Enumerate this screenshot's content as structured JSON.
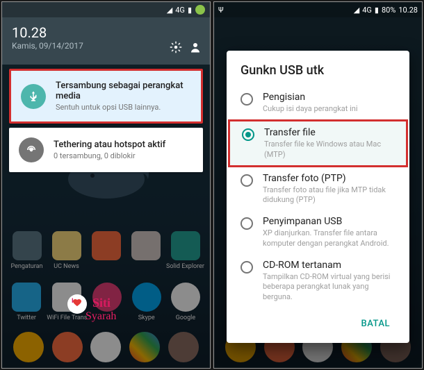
{
  "left": {
    "time": "10.28",
    "date": "Kamis, 09/14/2017",
    "signal": "4G",
    "notifications": [
      {
        "title": "Tersambung sebagai perangkat media",
        "subtitle": "Sentuh untuk opsi USB lainnya.",
        "icon": "usb-icon",
        "highlighted": true
      },
      {
        "title": "Tethering atau hotspot aktif",
        "subtitle": "0 tersambung, 0 diblokir",
        "icon": "hotspot-icon",
        "highlighted": false
      }
    ],
    "apps_row1": [
      "Pengaturan",
      "UC News",
      "",
      "",
      "Solid Explorer"
    ],
    "apps_row2": [
      "Twitter",
      "WiFi File Trans",
      "",
      "Skype",
      "Google"
    ]
  },
  "right": {
    "time": "10.28",
    "battery": "80%",
    "signal": "4G",
    "dialog_title": "Gunkn USB utk",
    "options": [
      {
        "label": "Pengisian",
        "sub": "Cukup isi daya perangkat ini",
        "checked": false,
        "highlighted": false
      },
      {
        "label": "Transfer file",
        "sub": "Transfer file ke Windows atau Mac (MTP)",
        "checked": true,
        "highlighted": true
      },
      {
        "label": "Transfer foto (PTP)",
        "sub": "Transfer foto atau file jika MTP tidak didukung (PTP)",
        "checked": false,
        "highlighted": false
      },
      {
        "label": "Penyimpanan USB",
        "sub": "XP dianjurkan. Transfer file antara komputer dengan perangkat Android.",
        "checked": false,
        "highlighted": false
      },
      {
        "label": "CD-ROM tertanam",
        "sub": "Tampilkan CD-ROM virtual yang berisi beberapa perangkat lunak yang berguna.",
        "checked": false,
        "highlighted": false
      }
    ],
    "cancel": "BATAL"
  },
  "colors": {
    "teal": "#009688",
    "highlight_red": "#d32f2f",
    "notif_bg": "#e3f2fd"
  }
}
